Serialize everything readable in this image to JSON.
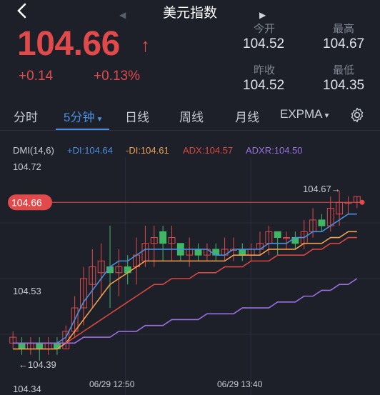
{
  "header": {
    "title": "美元指数"
  },
  "quote": {
    "price": "104.66",
    "change": "+0.14",
    "change_pct": "+0.13%",
    "open_label": "今开",
    "open": "104.52",
    "high_label": "最高",
    "high": "104.67",
    "prev_close_label": "昨收",
    "prev_close": "104.52",
    "low_label": "最低",
    "low": "104.35"
  },
  "tabs": [
    {
      "label": "分时"
    },
    {
      "label": "5分钟",
      "active": true
    },
    {
      "label": "日线"
    },
    {
      "label": "周线"
    },
    {
      "label": "月线"
    },
    {
      "label": "EXPMA"
    }
  ],
  "indicator": {
    "name": "DMI(14,6)",
    "pdi": "+DI:104.64",
    "mdi": "-DI:104.61",
    "adx": "ADX:104.57",
    "adxr": "ADXR:104.50"
  },
  "colors": {
    "up": "#e04a4a",
    "down": "#3fb866",
    "pdi": "#4a8fe0",
    "mdi": "#f0a050",
    "adx": "#d9473f",
    "adxr": "#9b6fe0"
  },
  "chart_data": {
    "type": "candlestick",
    "ylim": [
      104.34,
      104.72
    ],
    "y_ticks": [
      "104.72",
      "104.53",
      "104.34"
    ],
    "x_ticks": [
      "06/29 12:50",
      "06/29 13:40"
    ],
    "current_price_label": "104.66",
    "max_label": "104.67→",
    "min_label": "←104.39",
    "candles": [
      [
        104.42,
        104.43,
        104.41,
        104.44
      ],
      [
        104.42,
        104.41,
        104.4,
        104.43
      ],
      [
        104.41,
        104.42,
        104.4,
        104.43
      ],
      [
        104.42,
        104.41,
        104.39,
        104.43
      ],
      [
        104.41,
        104.42,
        104.4,
        104.43
      ],
      [
        104.42,
        104.41,
        104.4,
        104.43
      ],
      [
        104.41,
        104.44,
        104.41,
        104.45
      ],
      [
        104.44,
        104.48,
        104.43,
        104.5
      ],
      [
        104.48,
        104.53,
        104.45,
        104.55
      ],
      [
        104.52,
        104.55,
        104.48,
        104.58
      ],
      [
        104.54,
        104.56,
        104.5,
        104.59
      ],
      [
        104.55,
        104.54,
        104.48,
        104.62
      ],
      [
        104.54,
        104.55,
        104.5,
        104.58
      ],
      [
        104.55,
        104.54,
        104.52,
        104.57
      ],
      [
        104.55,
        104.57,
        104.52,
        104.6
      ],
      [
        104.56,
        104.59,
        104.55,
        104.62
      ],
      [
        104.59,
        104.6,
        104.55,
        104.62
      ],
      [
        104.61,
        104.59,
        104.56,
        104.62
      ],
      [
        104.59,
        104.6,
        104.56,
        104.62
      ],
      [
        104.59,
        104.57,
        104.56,
        104.59
      ],
      [
        104.57,
        104.58,
        104.55,
        104.6
      ],
      [
        104.58,
        104.57,
        104.56,
        104.59
      ],
      [
        104.57,
        104.58,
        104.56,
        104.59
      ],
      [
        104.58,
        104.57,
        104.56,
        104.59
      ],
      [
        104.57,
        104.58,
        104.56,
        104.6
      ],
      [
        104.58,
        104.58,
        104.56,
        104.6
      ],
      [
        104.58,
        104.57,
        104.56,
        104.59
      ],
      [
        104.57,
        104.58,
        104.56,
        104.59
      ],
      [
        104.58,
        104.59,
        104.57,
        104.61
      ],
      [
        104.59,
        104.61,
        104.57,
        104.62
      ],
      [
        104.61,
        104.6,
        104.57,
        104.61
      ],
      [
        104.6,
        104.6,
        104.58,
        104.61
      ],
      [
        104.6,
        104.59,
        104.58,
        104.61
      ],
      [
        104.59,
        104.61,
        104.58,
        104.63
      ],
      [
        104.61,
        104.63,
        104.6,
        104.65
      ],
      [
        104.63,
        104.62,
        104.61,
        104.64
      ],
      [
        104.62,
        104.65,
        104.61,
        104.67
      ],
      [
        104.64,
        104.66,
        104.62,
        104.68
      ],
      [
        104.66,
        104.66,
        104.64,
        104.67
      ],
      [
        104.66,
        104.67,
        104.65,
        104.67
      ]
    ],
    "series": [
      {
        "key": "pdi",
        "values": [
          104.42,
          104.42,
          104.42,
          104.42,
          104.42,
          104.42,
          104.43,
          104.46,
          104.49,
          104.51,
          104.53,
          104.55,
          104.56,
          104.56,
          104.57,
          104.58,
          104.58,
          104.58,
          104.58,
          104.58,
          104.58,
          104.58,
          104.58,
          104.57,
          104.57,
          104.58,
          104.58,
          104.58,
          104.58,
          104.59,
          104.59,
          104.59,
          104.6,
          104.6,
          104.61,
          104.61,
          104.62,
          104.63,
          104.64,
          104.64
        ]
      },
      {
        "key": "mdi",
        "values": [
          104.41,
          104.41,
          104.41,
          104.41,
          104.41,
          104.41,
          104.42,
          104.44,
          104.46,
          104.48,
          104.5,
          104.52,
          104.53,
          104.54,
          104.55,
          104.56,
          104.56,
          104.56,
          104.56,
          104.56,
          104.56,
          104.56,
          104.56,
          104.56,
          104.56,
          104.57,
          104.57,
          104.57,
          104.57,
          104.58,
          104.58,
          104.58,
          104.58,
          104.59,
          104.59,
          104.59,
          104.6,
          104.6,
          104.61,
          104.61
        ]
      },
      {
        "key": "adx",
        "values": [
          104.42,
          104.42,
          104.42,
          104.42,
          104.42,
          104.42,
          104.42,
          104.43,
          104.44,
          104.45,
          104.46,
          104.47,
          104.48,
          104.49,
          104.5,
          104.51,
          104.52,
          104.52,
          104.53,
          104.53,
          104.53,
          104.54,
          104.54,
          104.54,
          104.55,
          104.55,
          104.55,
          104.56,
          104.56,
          104.56,
          104.57,
          104.57,
          104.57,
          104.57,
          104.58,
          104.58,
          104.59,
          104.59,
          104.6,
          104.6
        ]
      },
      {
        "key": "adxr",
        "values": [
          104.42,
          104.42,
          104.42,
          104.42,
          104.42,
          104.42,
          104.42,
          104.42,
          104.43,
          104.43,
          104.43,
          104.43,
          104.44,
          104.44,
          104.44,
          104.45,
          104.45,
          104.45,
          104.46,
          104.46,
          104.46,
          104.46,
          104.47,
          104.47,
          104.47,
          104.47,
          104.48,
          104.48,
          104.48,
          104.48,
          104.49,
          104.49,
          104.49,
          104.5,
          104.5,
          104.51,
          104.51,
          104.52,
          104.52,
          104.53
        ]
      }
    ]
  }
}
